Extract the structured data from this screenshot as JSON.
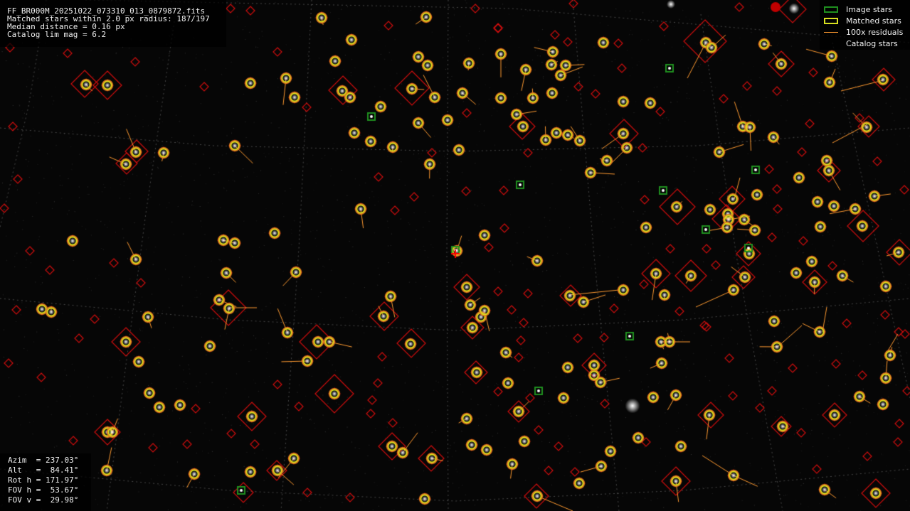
{
  "header": {
    "filename": "FF_BR000M_20251022_073310_013_0879872.fits",
    "matched_line": "Matched stars within 2.0 px radius: 187/197",
    "median_line": "Median distance = 0.16 px",
    "catalog_line": "Catalog lim mag = 6.2"
  },
  "legend": {
    "image_stars": {
      "label": "Image stars",
      "color": "#1f8f1f"
    },
    "matched_stars": {
      "label": "Matched stars",
      "color": "#d8e020"
    },
    "residuals": {
      "label": "100x residuals",
      "color": "#ff9a30"
    },
    "catalog_stars": {
      "label": "Catalog stars",
      "color": "#e01010"
    }
  },
  "footer": {
    "azim": "Azim  = 237.03°",
    "alt": "Alt   =  84.41°",
    "rot": "Rot h = 171.97°",
    "fov_h": "FOV h =  53.67°",
    "fov_v": "FOV v =  29.98°"
  }
}
